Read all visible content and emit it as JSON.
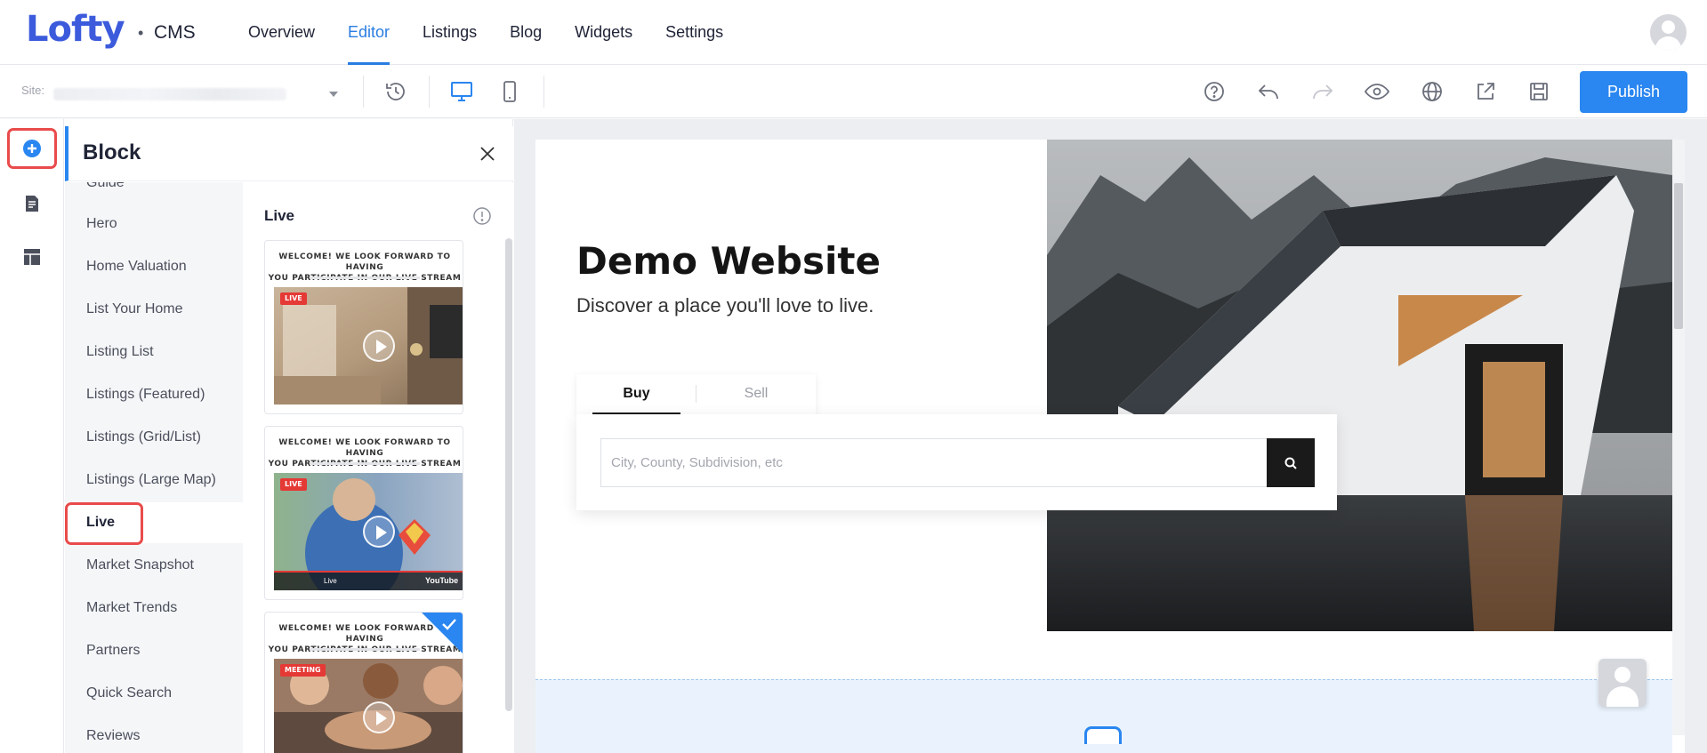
{
  "app": {
    "logo": "Lofty",
    "logo_separator": "•",
    "product": "CMS"
  },
  "nav": {
    "items": [
      {
        "label": "Overview"
      },
      {
        "label": "Editor",
        "active": true
      },
      {
        "label": "Listings"
      },
      {
        "label": "Blog"
      },
      {
        "label": "Widgets"
      },
      {
        "label": "Settings"
      }
    ]
  },
  "toolbar": {
    "site_label": "Site:",
    "publish_label": "Publish",
    "icons": [
      "history-icon",
      "desktop-icon",
      "mobile-icon",
      "help-icon",
      "undo-icon",
      "redo-icon",
      "preview-eye-icon",
      "globe-icon",
      "share-icon",
      "save-icon"
    ],
    "accent": "#2a86f0"
  },
  "rail": {
    "icons": [
      "add-block-icon",
      "pages-icon",
      "layout-icon"
    ]
  },
  "panel": {
    "title": "Block",
    "categories": [
      {
        "label": "Guide"
      },
      {
        "label": "Hero"
      },
      {
        "label": "Home Valuation"
      },
      {
        "label": "List Your Home"
      },
      {
        "label": "Listing List"
      },
      {
        "label": "Listings (Featured)"
      },
      {
        "label": "Listings (Grid/List)"
      },
      {
        "label": "Listings (Large Map)"
      },
      {
        "label": "Live",
        "active": true
      },
      {
        "label": "Market Snapshot"
      },
      {
        "label": "Market Trends"
      },
      {
        "label": "Partners"
      },
      {
        "label": "Quick Search"
      },
      {
        "label": "Reviews"
      }
    ],
    "section_title": "Live",
    "cards": [
      {
        "heading_line1": "WELCOME! WE LOOK FORWARD TO HAVING",
        "heading_line2": "YOU PARTICIPATE IN OUR LIVE STREAM",
        "badge": "LIVE"
      },
      {
        "heading_line1": "WELCOME! WE LOOK FORWARD TO HAVING",
        "heading_line2": "YOU PARTICIPATE IN OUR LIVE STREAM",
        "badge": "LIVE",
        "player_text": "Live",
        "player_brand": "YouTube"
      },
      {
        "heading_line1": "WELCOME! WE LOOK FORWARD TO HAVING",
        "heading_line2": "YOU PARTICIPATE IN OUR LIVE STREAM",
        "badge": "MEETING",
        "selected": true
      }
    ]
  },
  "preview": {
    "title": "Demo Website",
    "subtitle": "Discover a place you'll love to live.",
    "tab_buy": "Buy",
    "tab_sell": "Sell",
    "search_placeholder": "City, County, Subdivision, etc"
  },
  "colors": {
    "highlight_red": "#e94b4b",
    "brand_blue": "#3c5bdc",
    "link_blue": "#2a7de1"
  }
}
